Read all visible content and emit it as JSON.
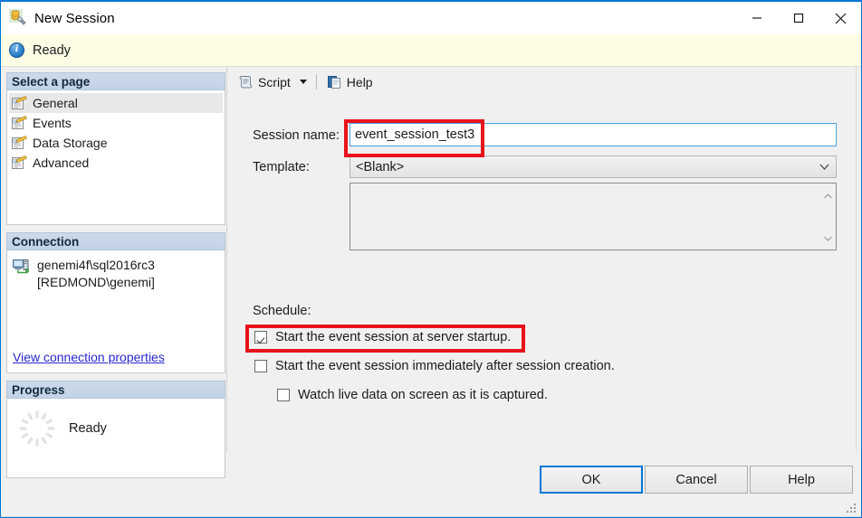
{
  "window": {
    "title": "New Session",
    "icon": "session-wizard-icon",
    "controls": {
      "minimize": "minimize-icon",
      "maximize": "maximize-icon",
      "close": "close-icon"
    }
  },
  "statusbar": {
    "icon": "info-icon",
    "text": "Ready"
  },
  "sidebar": {
    "pages_header": "Select a page",
    "pages": [
      {
        "label": "General",
        "icon": "page-icon",
        "selected": true
      },
      {
        "label": "Events",
        "icon": "page-icon",
        "selected": false
      },
      {
        "label": "Data Storage",
        "icon": "page-icon",
        "selected": false
      },
      {
        "label": "Advanced",
        "icon": "page-icon",
        "selected": false
      }
    ],
    "connection_header": "Connection",
    "connection": {
      "icon": "server-icon",
      "server": "genemi4f\\sql2016rc3",
      "user": "[REDMOND\\genemi]",
      "link": "View connection properties"
    },
    "progress_header": "Progress",
    "progress": {
      "icon": "spinner-icon",
      "text": "Ready"
    }
  },
  "toolbar": {
    "script_label": "Script",
    "script_icon": "script-scroll-icon",
    "script_caret": "chevron-down-icon",
    "help_label": "Help",
    "help_icon": "help-pages-icon"
  },
  "form": {
    "session_name_label": "Session name:",
    "session_name_value": "event_session_test3",
    "session_name_placeholder": "",
    "template_label": "Template:",
    "template_value": "<Blank>",
    "template_caret": "chevron-down-icon",
    "template_options": [
      "<Blank>"
    ],
    "description_value": "",
    "description_scroll_up": "scroll-up-icon",
    "description_scroll_down": "scroll-down-icon",
    "schedule_label": "Schedule:",
    "checkboxes": [
      {
        "label": "Start the event session at server startup.",
        "checked": true
      },
      {
        "label": "Start the event session immediately after session creation.",
        "checked": false
      },
      {
        "label": "Watch live data on screen as it is captured.",
        "checked": false
      }
    ]
  },
  "footer": {
    "ok_label": "OK",
    "cancel_label": "Cancel",
    "help_label": "Help"
  },
  "annotations": {
    "accent_color": "#e8121b",
    "focus_color": "#0078d7",
    "boxes": [
      {
        "name": "session-name-highlight",
        "target": "session-name-input"
      },
      {
        "name": "startup-checkbox-highlight",
        "target": "checkbox-server-startup"
      }
    ]
  }
}
